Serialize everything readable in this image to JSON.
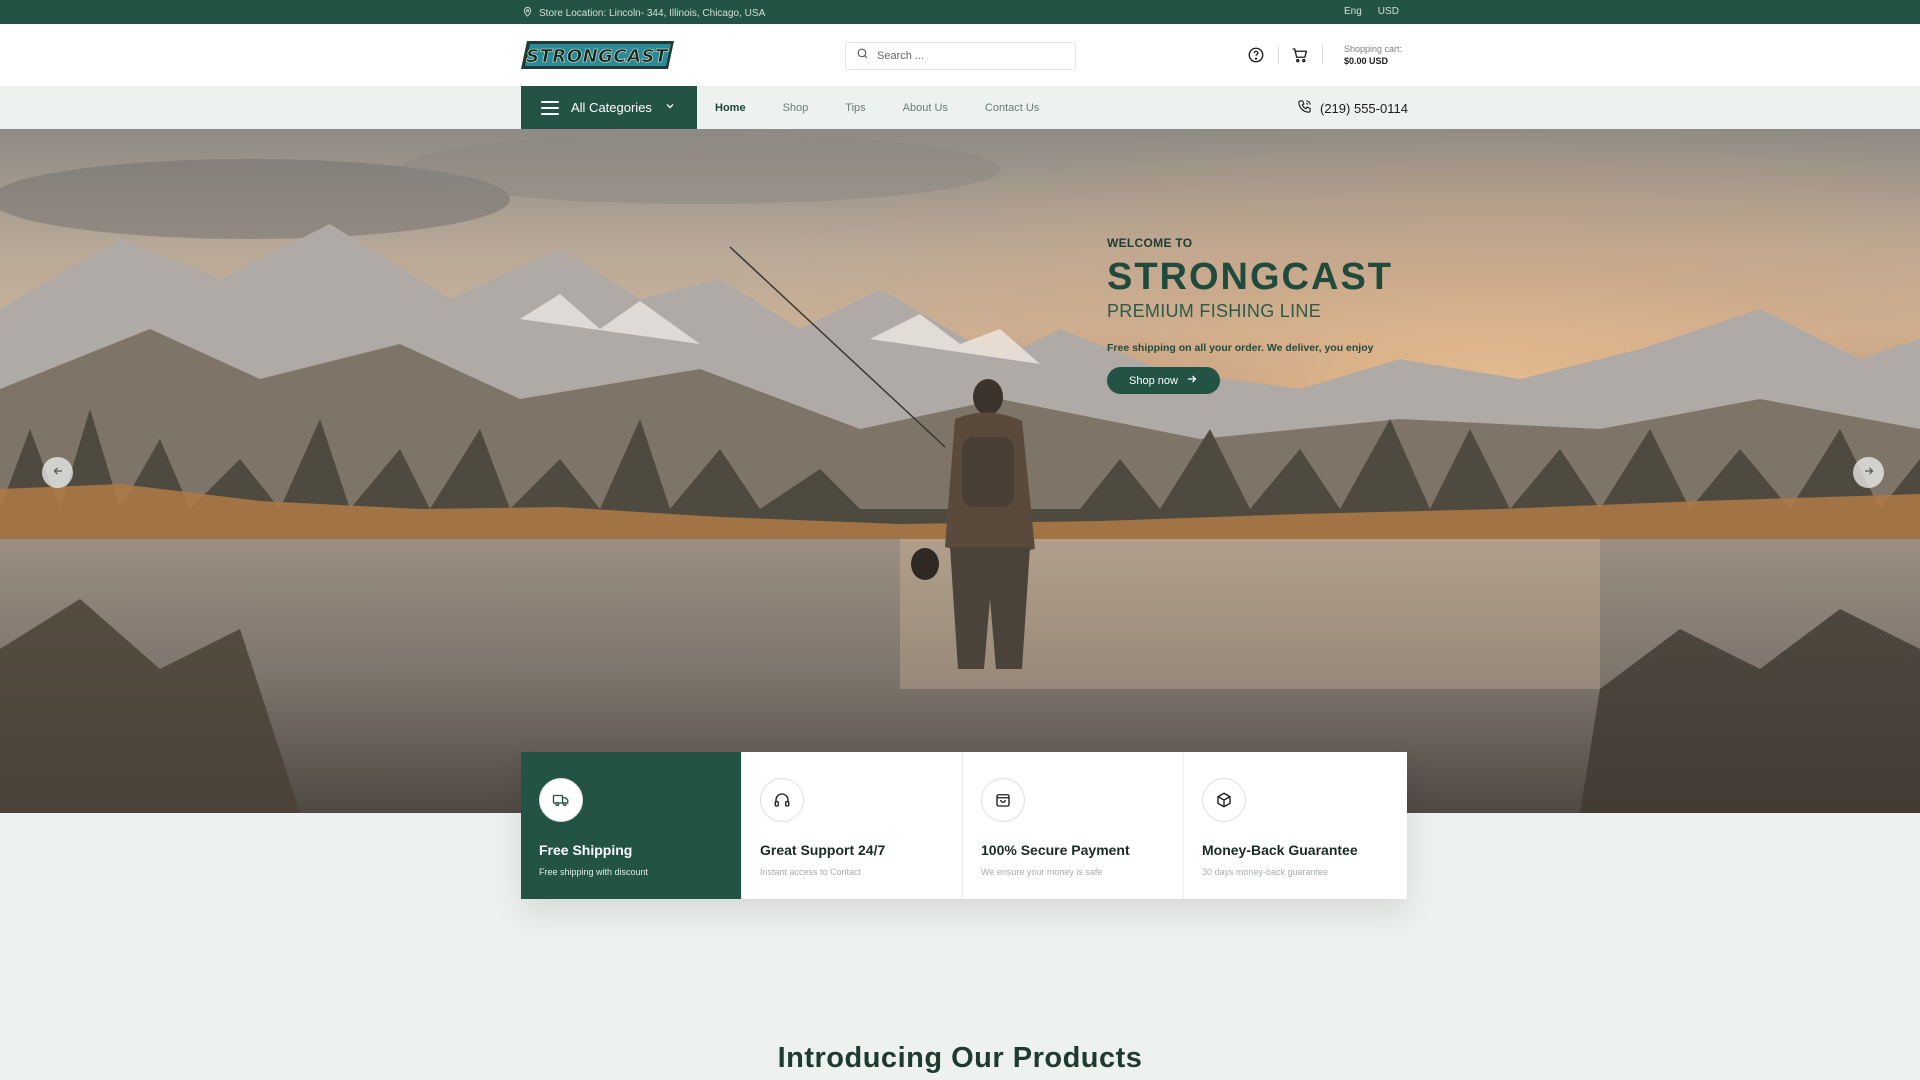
{
  "topbar": {
    "location": "Store Location: Lincoln- 344, Illinois, Chicago, USA",
    "language": "Eng",
    "currency": "USD"
  },
  "header": {
    "logo_text": "STRONGCAST",
    "search_placeholder": "Search ...",
    "cart_label": "Shopping cart:",
    "cart_value": "$0.00 USD"
  },
  "nav": {
    "all_categories": "All Categories",
    "links": [
      "Home",
      "Shop",
      "Tips",
      "About Us",
      "Contact Us"
    ],
    "active": "Home",
    "phone": "(219) 555-0114"
  },
  "hero": {
    "welcome": "WELCOME TO",
    "brand": "STRONGCAST",
    "subtitle": "PREMIUM FISHING LINE",
    "description": "Free shipping on all your order. We deliver, you enjoy",
    "cta": "Shop now"
  },
  "features": [
    {
      "title": "Free Shipping",
      "desc": "Free shipping with discount",
      "icon": "truck-icon"
    },
    {
      "title": "Great Support 24/7",
      "desc": "Instant access to Contact",
      "icon": "headphones-icon"
    },
    {
      "title": "100% Secure Payment",
      "desc": "We ensure your money is safe",
      "icon": "shopping-bag-icon"
    },
    {
      "title": "Money-Back Guarantee",
      "desc": "30 days money-back guarantee",
      "icon": "package-icon"
    }
  ],
  "section_title": "Introducing Our Products",
  "colors": {
    "brand_green": "#235344",
    "background": "#eef2ef",
    "logo_teal": "#1e7a8c"
  }
}
